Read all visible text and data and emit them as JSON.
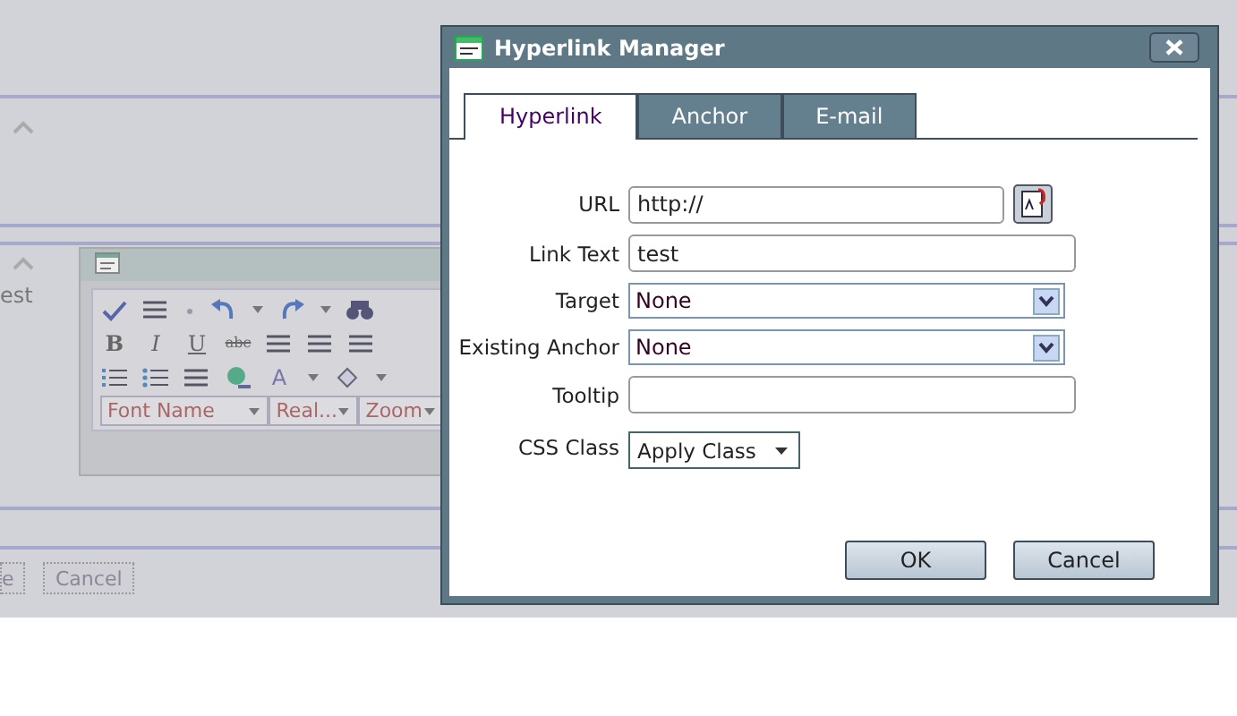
{
  "background": {
    "editor_text": "est",
    "editor": {
      "format_glyphs": [
        "B",
        "I",
        "U",
        "abc"
      ],
      "color_glyph": "A",
      "dropdowns": [
        "Font Name",
        "Real...",
        "Zoom"
      ]
    },
    "buttons": [
      "e",
      "Cancel"
    ]
  },
  "dialog": {
    "title": "Hyperlink Manager",
    "tabs": [
      {
        "label": "Hyperlink",
        "selected": true
      },
      {
        "label": "Anchor",
        "selected": false
      },
      {
        "label": "E-mail",
        "selected": false
      }
    ],
    "fields": [
      {
        "kind": "url",
        "label": "URL",
        "value": "http://"
      },
      {
        "kind": "text",
        "label": "Link Text",
        "value": "test"
      },
      {
        "kind": "select",
        "label": "Target",
        "value": "None"
      },
      {
        "kind": "select",
        "label": "Existing Anchor",
        "value": "None"
      },
      {
        "kind": "text",
        "label": "Tooltip"
      },
      {
        "kind": "class",
        "label": "CSS Class",
        "value": "Apply Class"
      }
    ],
    "buttons": [
      "OK",
      "Cancel"
    ]
  }
}
